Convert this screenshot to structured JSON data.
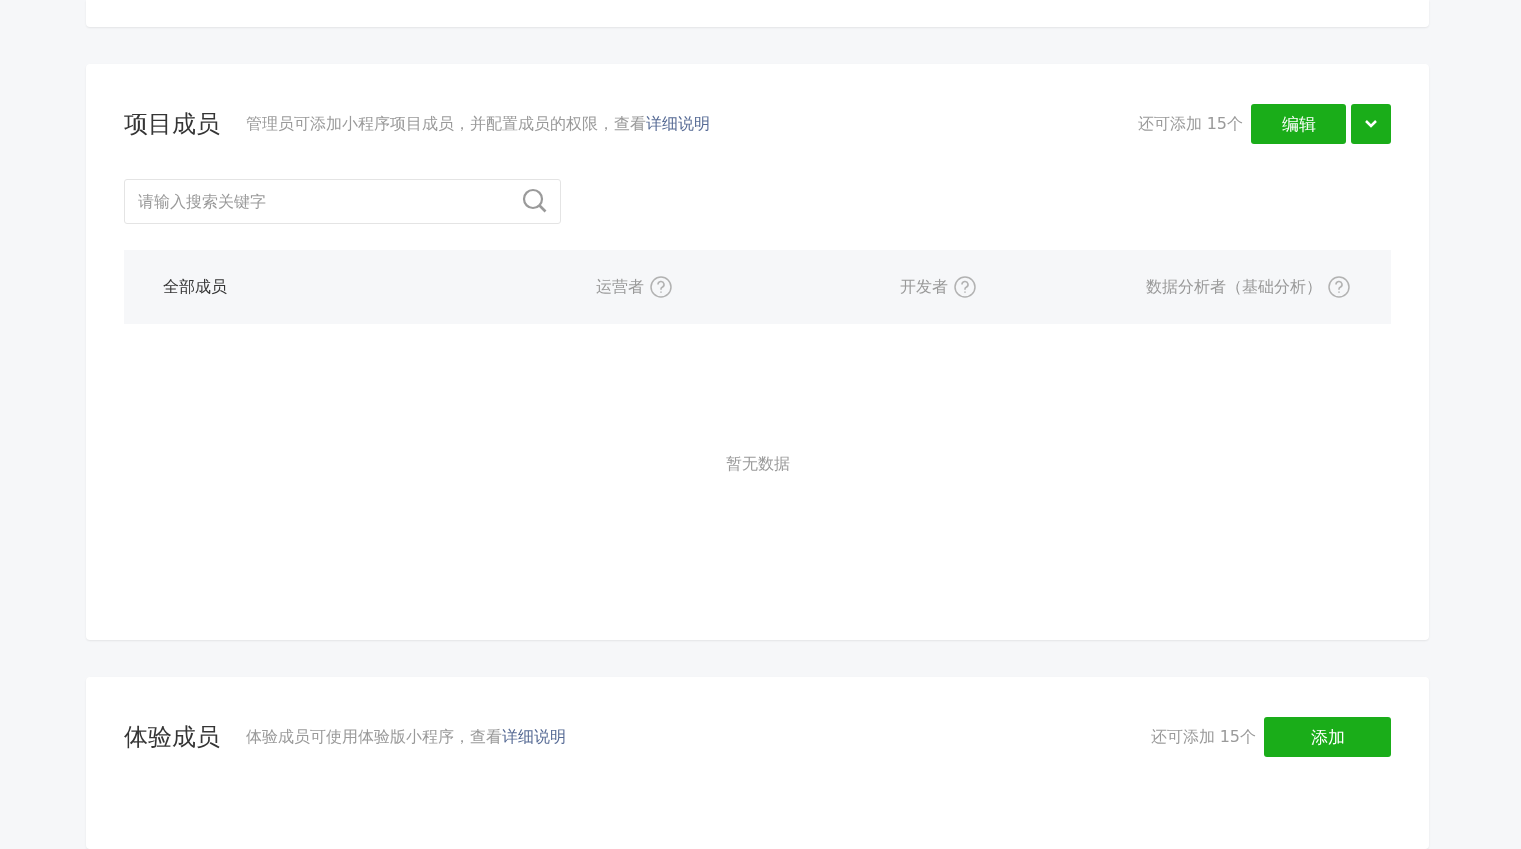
{
  "project_members": {
    "title": "项目成员",
    "description": "管理员可添加小程序项目成员，并配置成员的权限，查看",
    "link": "详细说明",
    "remaining": "还可添加 15个",
    "button": "编辑",
    "search": {
      "placeholder": "请输入搜索关键字"
    },
    "columns": [
      {
        "label": "全部成员",
        "help": false
      },
      {
        "label": "运营者",
        "help": true
      },
      {
        "label": "开发者",
        "help": true
      },
      {
        "label": "数据分析者（基础分析）",
        "help": true
      }
    ],
    "empty": "暂无数据"
  },
  "trial_members": {
    "title": "体验成员",
    "description": "体验成员可使用体验版小程序，查看",
    "link": "详细说明",
    "remaining": "还可添加 15个",
    "button": "添加"
  }
}
